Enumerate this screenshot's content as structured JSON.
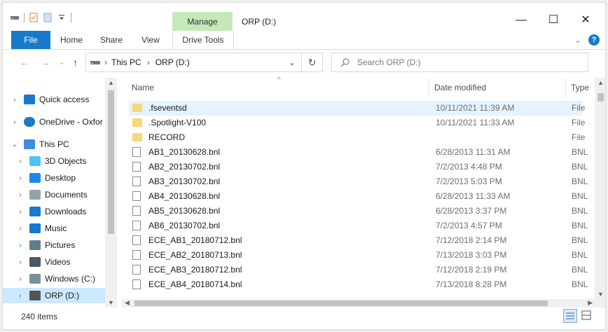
{
  "window": {
    "title": "ORP (D:)",
    "context_tab": "Manage",
    "controls": [
      "—",
      "☐",
      "✕"
    ]
  },
  "ribbon": {
    "tabs": [
      "File",
      "Home",
      "Share",
      "View",
      "Drive Tools"
    ],
    "expand_glyph": "⌄",
    "help_glyph": "?"
  },
  "nav": {
    "back": "←",
    "forward": "→",
    "recent": "⌄",
    "up": "↑",
    "breadcrumb": [
      "This PC",
      "ORP (D:)"
    ],
    "separator": "›",
    "dropdown": "⌄",
    "refresh": "↻",
    "search_placeholder": "Search ORP (D:)"
  },
  "sidebar": {
    "items": [
      {
        "label": "Quick access",
        "icon": "star-icon",
        "chev": "›",
        "color": "#1979ca"
      },
      {
        "label": "OneDrive - Oxfor",
        "icon": "cloud-icon",
        "chev": "›",
        "color": "#1979ca"
      },
      {
        "label": "This PC",
        "icon": "computer-icon",
        "chev": "⌄",
        "color": "#3a8de0"
      },
      {
        "label": "3D Objects",
        "icon": "cube-icon",
        "chev": "›",
        "color": "#4fc3f7"
      },
      {
        "label": "Desktop",
        "icon": "desktop-icon",
        "chev": "›",
        "color": "#1e88e5"
      },
      {
        "label": "Documents",
        "icon": "documents-icon",
        "chev": "›",
        "color": "#90a4ae"
      },
      {
        "label": "Downloads",
        "icon": "download-icon",
        "chev": "›",
        "color": "#1979ca"
      },
      {
        "label": "Music",
        "icon": "music-icon",
        "chev": "›",
        "color": "#1976d2"
      },
      {
        "label": "Pictures",
        "icon": "pictures-icon",
        "chev": "›",
        "color": "#607d8b"
      },
      {
        "label": "Videos",
        "icon": "videos-icon",
        "chev": "›",
        "color": "#455a64"
      },
      {
        "label": "Windows (C:)",
        "icon": "drive-c-icon",
        "chev": "›",
        "color": "#78909c"
      },
      {
        "label": "ORP (D:)",
        "icon": "drive-icon",
        "chev": "›",
        "color": "#555555"
      }
    ]
  },
  "list": {
    "columns": {
      "name": "Name",
      "date": "Date modified",
      "type": "Type"
    },
    "sort_glyph": "^",
    "rows": [
      {
        "name": ".fseventsd",
        "date": "10/11/2021 11:39 AM",
        "type": "File",
        "icon": "folder-icon"
      },
      {
        "name": ".Spotlight-V100",
        "date": "10/11/2021 11:33 AM",
        "type": "File",
        "icon": "folder-icon"
      },
      {
        "name": "RECORD",
        "date": "",
        "type": "File",
        "icon": "folder-icon"
      },
      {
        "name": "AB1_20130628.bnl",
        "date": "6/28/2013 11:31 AM",
        "type": "BNL",
        "icon": "file-icon"
      },
      {
        "name": "AB2_20130702.bnl",
        "date": "7/2/2013 4:48 PM",
        "type": "BNL",
        "icon": "file-icon"
      },
      {
        "name": "AB3_20130702.bnl",
        "date": "7/2/2013 5:03 PM",
        "type": "BNL",
        "icon": "file-icon"
      },
      {
        "name": "AB4_20130628.bnl",
        "date": "6/28/2013 11:33 AM",
        "type": "BNL",
        "icon": "file-icon"
      },
      {
        "name": "AB5_20130628.bnl",
        "date": "6/28/2013 3:37 PM",
        "type": "BNL",
        "icon": "file-icon"
      },
      {
        "name": "AB6_20130702.bnl",
        "date": "7/2/2013 4:57 PM",
        "type": "BNL",
        "icon": "file-icon"
      },
      {
        "name": "ECE_AB1_20180712.bnl",
        "date": "7/12/2018 2:14 PM",
        "type": "BNL",
        "icon": "file-icon"
      },
      {
        "name": "ECE_AB2_20180713.bnl",
        "date": "7/13/2018 3:03 PM",
        "type": "BNL",
        "icon": "file-icon"
      },
      {
        "name": "ECE_AB3_20180712.bnl",
        "date": "7/12/2018 2:19 PM",
        "type": "BNL",
        "icon": "file-icon"
      },
      {
        "name": "ECE_AB4_20180714.bnl",
        "date": "7/13/2018 8:28 PM",
        "type": "BNL",
        "icon": "file-icon"
      }
    ]
  },
  "status": {
    "count": "240 items"
  },
  "colors": {
    "accent": "#1979ca",
    "manage": "#c5e9b8",
    "selected": "#cce8ff",
    "folder": "#f8d775"
  }
}
